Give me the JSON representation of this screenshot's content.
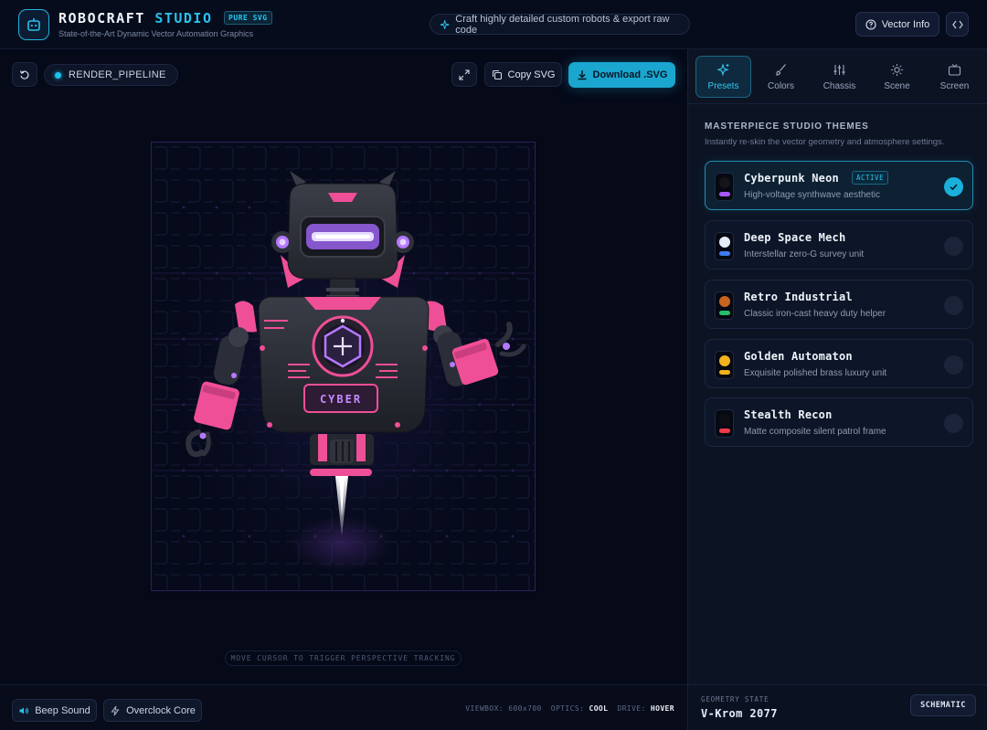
{
  "header": {
    "brand_main": "ROBOCRAFT",
    "brand_accent": "STUDIO",
    "badge": "PURE SVG",
    "subtitle": "State-of-the-Art Dynamic Vector Automation Graphics",
    "pill_text": "Craft highly detailed custom robots & export raw code",
    "vector_info_label": "Vector Info",
    "icons": {
      "logo": "robot-icon",
      "pill": "sparkle-icon",
      "vector_info": "help-circle-icon",
      "code": "code-icon"
    },
    "accent_color": "#27c2ee"
  },
  "toolbar": {
    "pipeline_label": "RENDER_PIPELINE",
    "copy_label": "Copy SVG",
    "download_label": "Download .SVG",
    "icons": {
      "reset": "rotate-ccw-icon",
      "expand": "expand-icon",
      "copy": "copy-icon",
      "download": "download-icon"
    }
  },
  "robot": {
    "chest_label": "CYBER",
    "primary_color": "#ef4f96",
    "visor_color": "#b678ff",
    "body_color": "#2e313b"
  },
  "canvas": {
    "hint": "MOVE CURSOR TO TRIGGER PERSPECTIVE TRACKING"
  },
  "bottom": {
    "beep_label": "Beep Sound",
    "overclock_label": "Overclock Core",
    "viewbox_key": "VIEWBOX:",
    "viewbox_value": "600x700",
    "optics_key": "OPTICS:",
    "optics_value": "COOL",
    "drive_key": "DRIVE:",
    "drive_value": "HOVER",
    "icons": {
      "beep": "volume-icon",
      "overclock": "lightning-icon"
    }
  },
  "sidebar": {
    "tabs": [
      {
        "label": "Presets",
        "icon": "sparkles-icon",
        "active": true
      },
      {
        "label": "Colors",
        "icon": "brush-icon",
        "active": false
      },
      {
        "label": "Chassis",
        "icon": "sliders-icon",
        "active": false
      },
      {
        "label": "Scene",
        "icon": "sun-icon",
        "active": false
      },
      {
        "label": "Screen",
        "icon": "tv-icon",
        "active": false
      }
    ],
    "section_title": "MASTERPIECE STUDIO THEMES",
    "section_subtitle": "Instantly re-skin the vector geometry and atmosphere settings.",
    "active_badge": "ACTIVE",
    "themes": [
      {
        "name": "Cyberpunk Neon",
        "desc": "High-voltage synthwave aesthetic",
        "top_color": "#141419",
        "bar_color": "#a657ff",
        "active": true
      },
      {
        "name": "Deep Space Mech",
        "desc": "Interstellar zero-G survey unit",
        "top_color": "#e8edf6",
        "bar_color": "#3d7cf0",
        "active": false
      },
      {
        "name": "Retro Industrial",
        "desc": "Classic iron-cast heavy duty helper",
        "top_color": "#c8641f",
        "bar_color": "#27c06a",
        "active": false
      },
      {
        "name": "Golden Automaton",
        "desc": "Exquisite polished brass luxury unit",
        "top_color": "#f2b21d",
        "bar_color": "#f2b21d",
        "active": false
      },
      {
        "name": "Stealth Recon",
        "desc": "Matte composite silent patrol frame",
        "top_color": "#0d0f14",
        "bar_color": "#ee3a4a",
        "active": false
      }
    ],
    "geometry_label": "GEOMETRY STATE",
    "geometry_value": "V-Krom 2077",
    "schematic_label": "SCHEMATIC"
  }
}
